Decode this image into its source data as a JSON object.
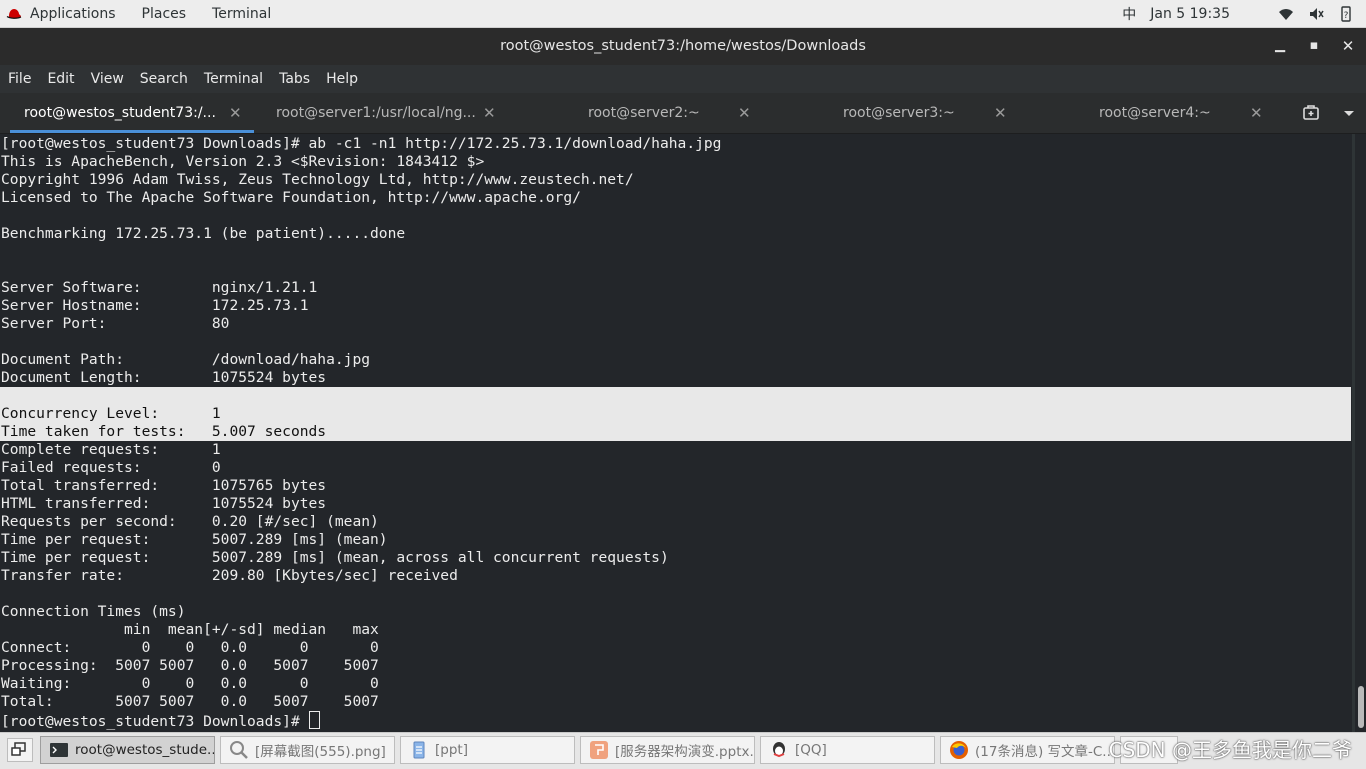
{
  "topbar": {
    "applications": "Applications",
    "places": "Places",
    "terminal": "Terminal",
    "input_method": "中",
    "datetime": "Jan 5  19:35"
  },
  "window": {
    "title": "root@westos_student73:/home/westos/Downloads"
  },
  "menu": [
    "File",
    "Edit",
    "View",
    "Search",
    "Terminal",
    "Tabs",
    "Help"
  ],
  "tabs": [
    {
      "label": "root@westos_student73:/..."
    },
    {
      "label": "root@server1:/usr/local/ng..."
    },
    {
      "label": "root@server2:~"
    },
    {
      "label": "root@server3:~"
    },
    {
      "label": "root@server4:~"
    }
  ],
  "terminal": {
    "lines": [
      "[root@westos_student73 Downloads]# ab -c1 -n1 http://172.25.73.1/download/haha.jpg",
      "This is ApacheBench, Version 2.3 <$Revision: 1843412 $>",
      "Copyright 1996 Adam Twiss, Zeus Technology Ltd, http://www.zeustech.net/",
      "Licensed to The Apache Software Foundation, http://www.apache.org/",
      "",
      "Benchmarking 172.25.73.1 (be patient).....done",
      "",
      "",
      "Server Software:        nginx/1.21.1",
      "Server Hostname:        172.25.73.1",
      "Server Port:            80",
      "",
      "Document Path:          /download/haha.jpg",
      "Document Length:        1075524 bytes",
      "",
      "Concurrency Level:      1",
      "Time taken for tests:   5.007 seconds",
      "Complete requests:      1",
      "Failed requests:        0",
      "Total transferred:      1075765 bytes",
      "HTML transferred:       1075524 bytes",
      "Requests per second:    0.20 [#/sec] (mean)",
      "Time per request:       5007.289 [ms] (mean)",
      "Time per request:       5007.289 [ms] (mean, across all concurrent requests)",
      "Transfer rate:          209.80 [Kbytes/sec] received",
      "",
      "Connection Times (ms)",
      "              min  mean[+/-sd] median   max",
      "Connect:        0    0   0.0      0       0",
      "Processing:  5007 5007   0.0   5007    5007",
      "Waiting:        0    0   0.0      0       0",
      "Total:       5007 5007   0.0   5007    5007"
    ],
    "prompt": "[root@westos_student73 Downloads]# "
  },
  "taskbar": [
    {
      "label": "root@westos_stude...",
      "icon": "terminal-icon"
    },
    {
      "label": "[屏幕截图(555).png]",
      "icon": "image-viewer-icon"
    },
    {
      "label": "[ppt]",
      "icon": "document-icon"
    },
    {
      "label": "[服务器架构演变.pptx...",
      "icon": "presentation-icon"
    },
    {
      "label": "[QQ]",
      "icon": "qq-icon"
    },
    {
      "label": "(17条消息) 写文章-C...",
      "icon": "firefox-icon"
    }
  ],
  "watermark": "CSDN @王多鱼我是你二爷",
  "colors": {
    "terminal_bg": "#23262a",
    "terminal_fg": "#ececec",
    "selection": "#e8e8e8",
    "active_tab_underline": "#4a90d9"
  }
}
